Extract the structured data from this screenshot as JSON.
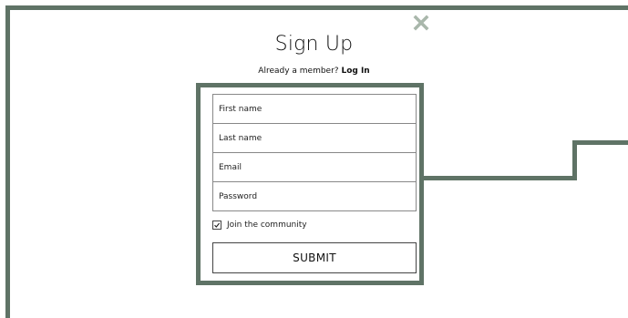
{
  "modal": {
    "title": "Sign Up",
    "member_prompt": "Already a member?",
    "login_link": "Log In"
  },
  "form": {
    "first_name_placeholder": "First name",
    "last_name_placeholder": "Last name",
    "email_placeholder": "Email",
    "password_placeholder": "Password",
    "checkbox_label": "Join the community",
    "checkbox_checked": true,
    "submit_label": "SUBMIT"
  },
  "icons": {
    "close": "close-icon",
    "checkmark": "checkmark-icon"
  },
  "colors": {
    "accent": "#5f7366",
    "close_icon": "#a9b7ab",
    "background": "#ffffff"
  }
}
